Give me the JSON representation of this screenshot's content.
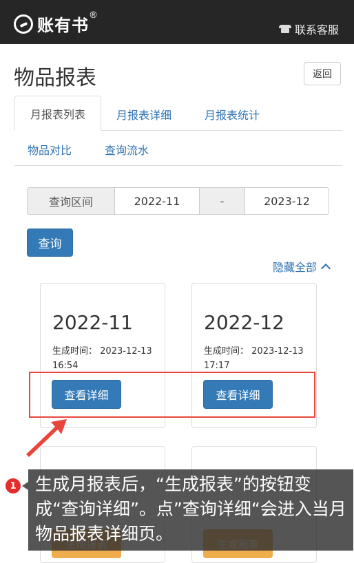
{
  "header": {
    "brand": "账有书",
    "brand_mark": "®",
    "service_label": "联系客服"
  },
  "page": {
    "title": "物品报表",
    "back_label": "返回"
  },
  "tabs": [
    {
      "label": "月报表列表",
      "active": true
    },
    {
      "label": "月报表详细",
      "active": false
    },
    {
      "label": "月报表统计",
      "active": false
    },
    {
      "label": "物品对比",
      "active": false
    },
    {
      "label": "查询流水",
      "active": false
    }
  ],
  "query": {
    "range_label": "查询区间",
    "start": "2022-11",
    "separator": "-",
    "end": "2023-12",
    "button_label": "查询"
  },
  "toggle": {
    "hide_all_label": "隐藏全部"
  },
  "cards": [
    {
      "month": "2022-11",
      "time_label": "生成时间：",
      "time": "2023-12-13 16:54",
      "button_label": "查看详细"
    },
    {
      "month": "2022-12",
      "time_label": "生成时间：",
      "time": "2023-12-13 17:17",
      "button_label": "查看详细"
    }
  ],
  "partial_cards": [
    {
      "button_label": "生成报表"
    },
    {
      "button_label": "生成报表"
    }
  ],
  "annotation": {
    "step_number": "1",
    "text": "生成月报表后，“生成报表”的按钮变成“查询详细”。点”查询详细“会进入当月物品报表详细页。"
  },
  "colors": {
    "topbar": "#262626",
    "primary": "#337ab7",
    "link": "#2f73b4",
    "warning": "#f0ad4e",
    "highlight": "#e8463c"
  }
}
